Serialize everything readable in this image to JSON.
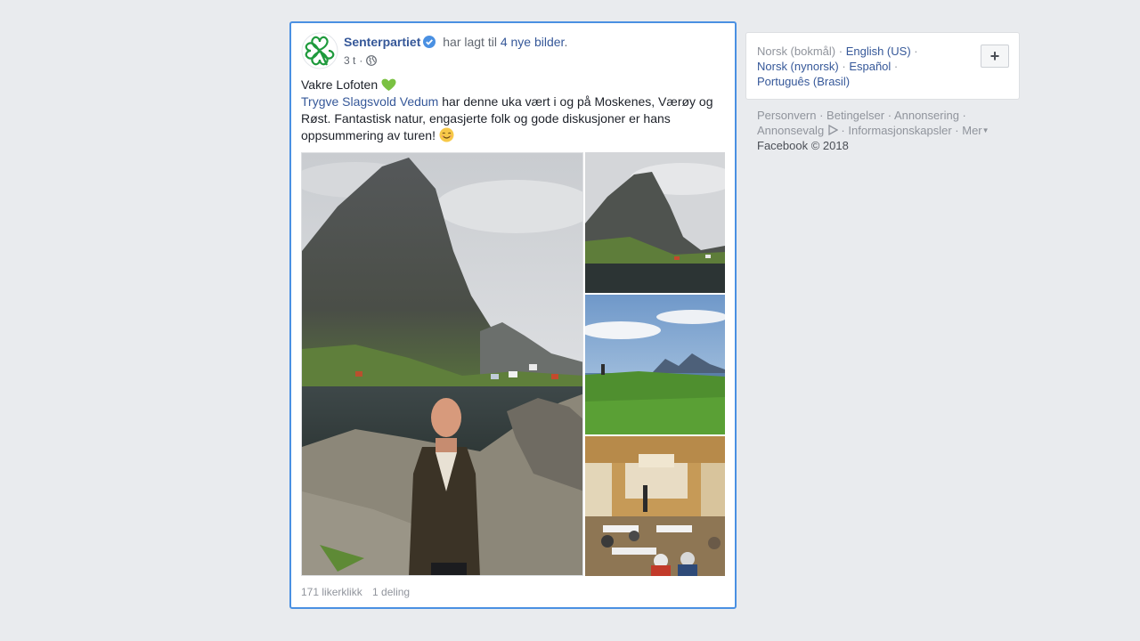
{
  "post": {
    "page_name": "Senterpartiet",
    "action_text": "har lagt til",
    "photos_link": "4 nye bilder",
    "period": ".",
    "time": "3 t",
    "dot": "·",
    "text_line1": "Vakre Lofoten",
    "mention": "Trygve Slagsvold Vedum",
    "text_body": " har denne uka vært i og på Moskenes, Værøy og Røst. Fantastisk natur, engasjerte folk og gode diskusjoner er hans oppsummering av turen!",
    "likes": "171 likerklikk",
    "shares": "1 deling"
  },
  "sidebar": {
    "languages": {
      "current": "Norsk (bokmål)",
      "options": [
        "English (US)",
        "Norsk (nynorsk)",
        "Español",
        "Português (Brasil)"
      ]
    },
    "add_button": "+",
    "footer_links": [
      "Personvern",
      "Betingelser",
      "Annonsering",
      "Annonsevalg",
      "Informasjonskapsler",
      "Mer"
    ],
    "copyright": "Facebook © 2018"
  },
  "colors": {
    "link": "#365899",
    "focus_border": "#4a90e2",
    "background": "#e9ebee",
    "muted": "#90949c"
  },
  "icons": [
    "clover-logo-icon",
    "verified-badge-icon",
    "globe-icon",
    "green-heart-icon",
    "smiling-face-icon",
    "ad-choices-icon",
    "caret-down-icon"
  ]
}
